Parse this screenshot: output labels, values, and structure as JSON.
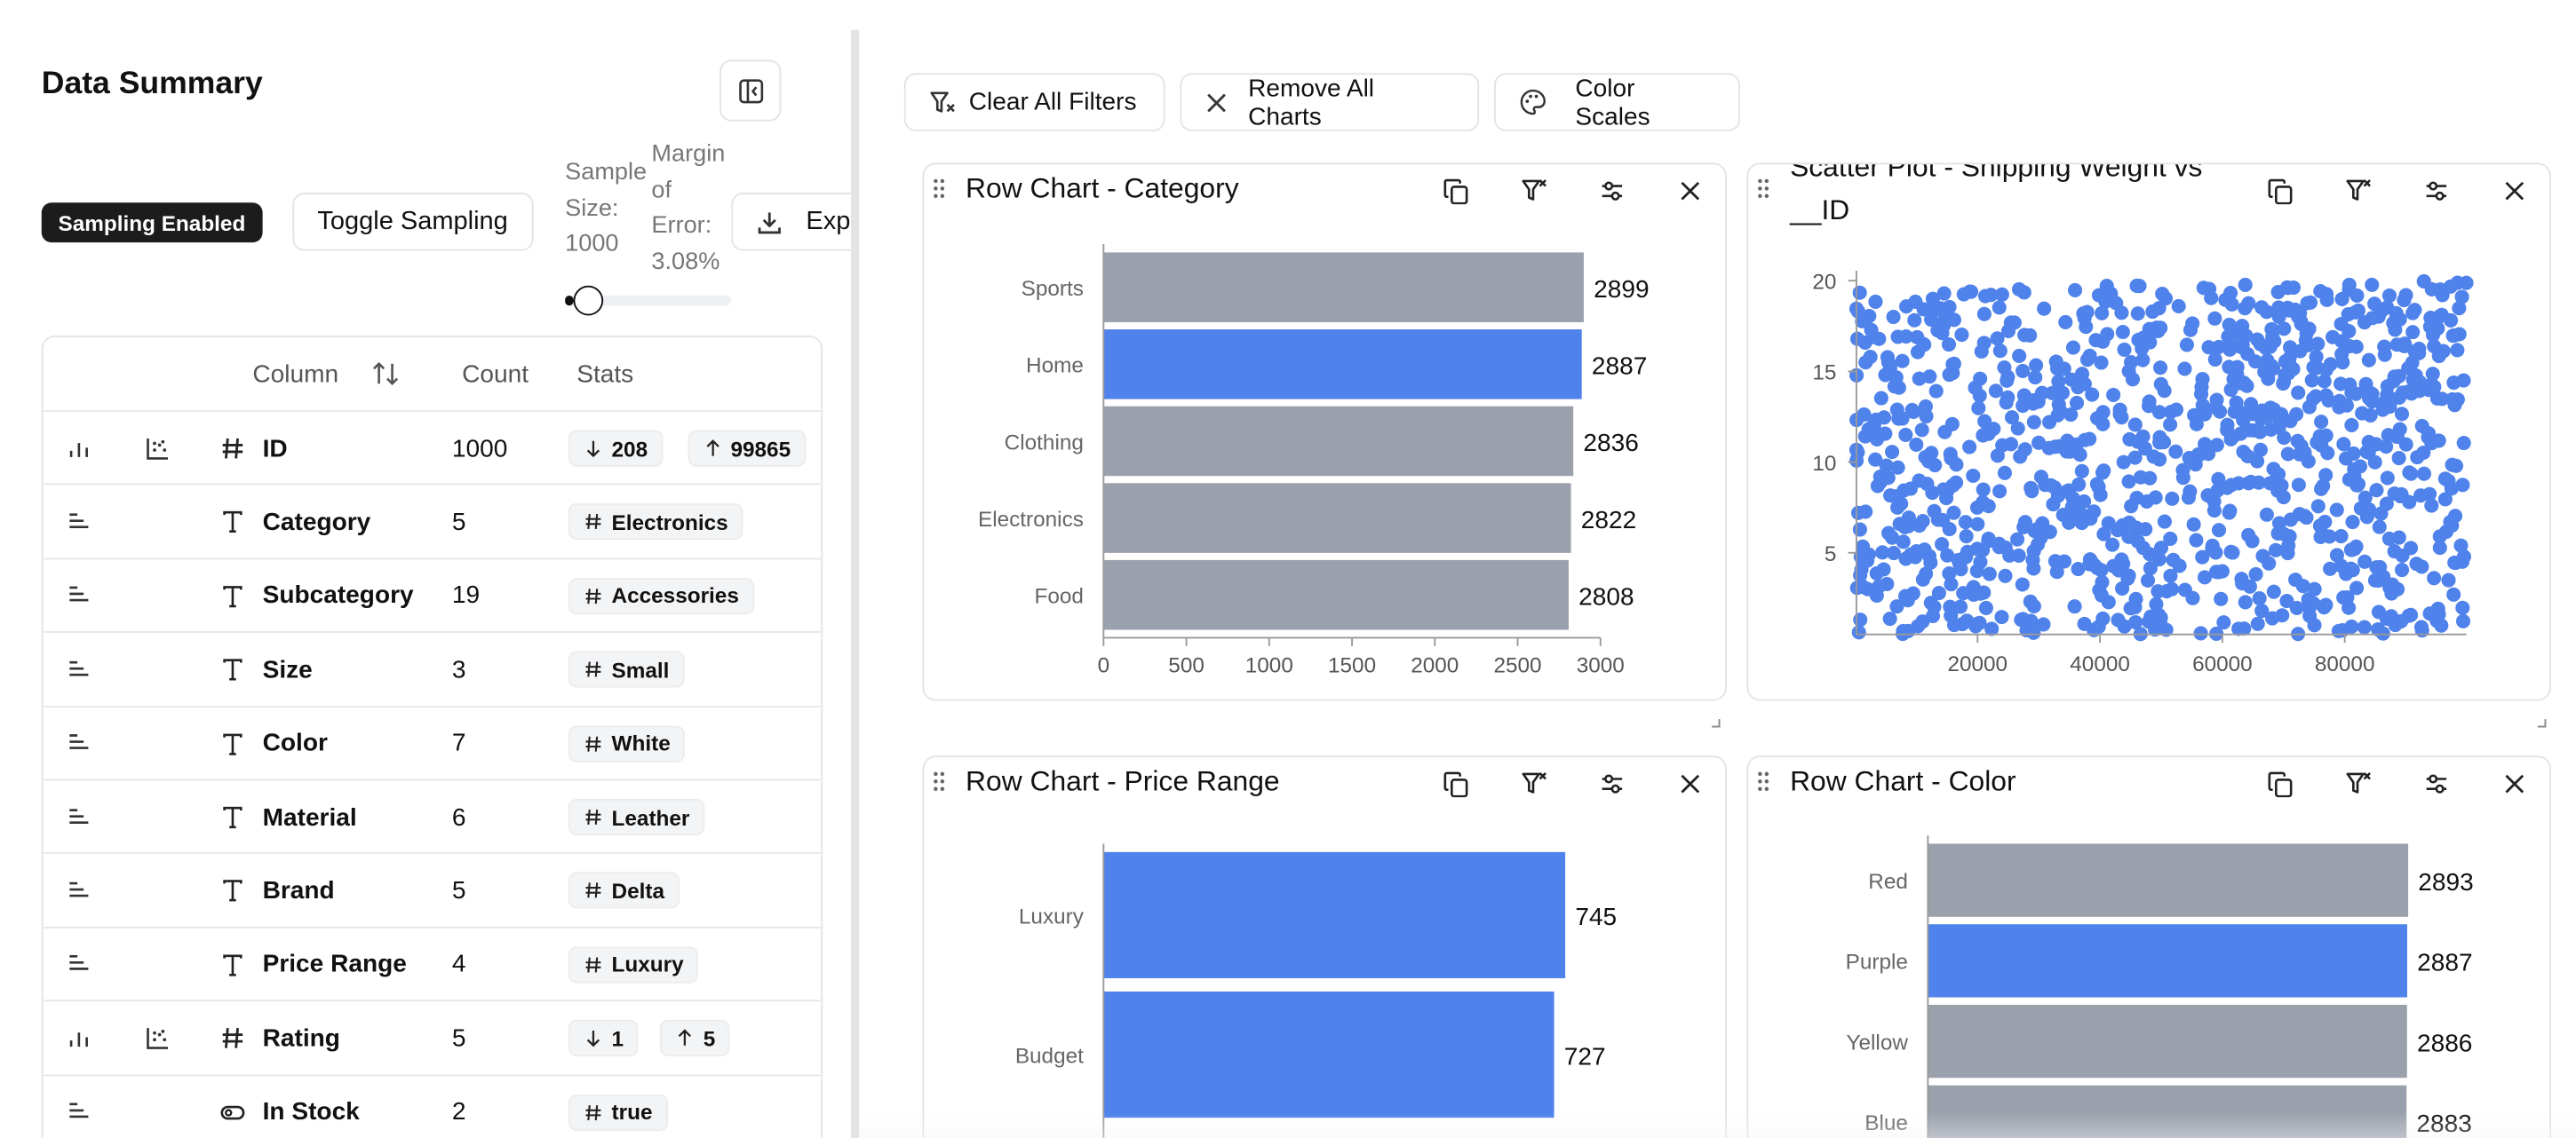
{
  "sidebar": {
    "title": "Data Summary",
    "sampling_badge": "Sampling Enabled",
    "toggle_button": "Toggle Sampling",
    "export_button": "Exp",
    "sample_size_label": "Sample Size: 1000",
    "margin_of_error_label": "Margin of Error: 3.08%",
    "sample_slider_fraction": 0.05,
    "table": {
      "headers": {
        "column": "Column",
        "count": "Count",
        "stats": "Stats"
      },
      "rows": [
        {
          "name": "ID",
          "type_icon": "hash-icon",
          "count": "1000",
          "numeric": true,
          "stats": [
            {
              "icon": "arrow-down-icon",
              "text": "208"
            },
            {
              "icon": "arrow-up-icon",
              "text": "99865"
            }
          ]
        },
        {
          "name": "Category",
          "type_icon": "text-type-icon",
          "count": "5",
          "numeric": false,
          "stats": [
            {
              "icon": "hash-icon",
              "text": "Electronics"
            }
          ]
        },
        {
          "name": "Subcategory",
          "type_icon": "text-type-icon",
          "count": "19",
          "numeric": false,
          "stats": [
            {
              "icon": "hash-icon",
              "text": "Accessories"
            }
          ]
        },
        {
          "name": "Size",
          "type_icon": "text-type-icon",
          "count": "3",
          "numeric": false,
          "stats": [
            {
              "icon": "hash-icon",
              "text": "Small"
            }
          ]
        },
        {
          "name": "Color",
          "type_icon": "text-type-icon",
          "count": "7",
          "numeric": false,
          "stats": [
            {
              "icon": "hash-icon",
              "text": "White"
            }
          ]
        },
        {
          "name": "Material",
          "type_icon": "text-type-icon",
          "count": "6",
          "numeric": false,
          "stats": [
            {
              "icon": "hash-icon",
              "text": "Leather"
            }
          ]
        },
        {
          "name": "Brand",
          "type_icon": "text-type-icon",
          "count": "5",
          "numeric": false,
          "stats": [
            {
              "icon": "hash-icon",
              "text": "Delta"
            }
          ]
        },
        {
          "name": "Price Range",
          "type_icon": "text-type-icon",
          "count": "4",
          "numeric": false,
          "stats": [
            {
              "icon": "hash-icon",
              "text": "Luxury"
            }
          ]
        },
        {
          "name": "Rating",
          "type_icon": "hash-icon",
          "count": "5",
          "numeric": true,
          "stats": [
            {
              "icon": "arrow-down-icon",
              "text": "1"
            },
            {
              "icon": "arrow-up-icon",
              "text": "5"
            }
          ]
        },
        {
          "name": "In Stock",
          "type_icon": "toggle-icon",
          "count": "2",
          "numeric": false,
          "stats": [
            {
              "icon": "hash-icon",
              "text": "true"
            }
          ]
        }
      ]
    }
  },
  "toolbar": {
    "clear_filters": "Clear All Filters",
    "remove_charts": "Remove All Charts",
    "color_scales": "Color Scales"
  },
  "colors": {
    "accent": "#4f82ea",
    "bar_gray": "#9ba1ac"
  },
  "charts": [
    {
      "title": "Row Chart - Category"
    },
    {
      "title": "Scatter Plot - Shipping Weight vs __ID"
    },
    {
      "title": "Row Chart - Price Range"
    },
    {
      "title": "Row Chart - Color"
    }
  ],
  "chart_data": [
    {
      "type": "bar",
      "orientation": "horizontal",
      "title": "Row Chart - Category",
      "categories": [
        "Sports",
        "Home",
        "Clothing",
        "Electronics",
        "Food"
      ],
      "values": [
        2899,
        2887,
        2836,
        2822,
        2808
      ],
      "selected": [
        false,
        true,
        false,
        false,
        false
      ],
      "xlim": [
        0,
        3000
      ],
      "xticks": [
        0,
        500,
        1000,
        1500,
        2000,
        2500,
        3000
      ]
    },
    {
      "type": "scatter",
      "title": "Scatter Plot - Shipping Weight vs __ID",
      "xlim": [
        208,
        99865
      ],
      "ylim": [
        0.5,
        20
      ],
      "xticks": [
        20000,
        40000,
        60000,
        80000
      ],
      "yticks": [
        5,
        10,
        15,
        20
      ],
      "points": "1000 points uniformly spread over x 208–99865, y 0.5–20"
    },
    {
      "type": "bar",
      "orientation": "horizontal",
      "title": "Row Chart - Price Range",
      "categories": [
        "Luxury",
        "Budget"
      ],
      "values": [
        745,
        727
      ],
      "selected": [
        true,
        true
      ]
    },
    {
      "type": "bar",
      "orientation": "horizontal",
      "title": "Row Chart - Color",
      "categories": [
        "Red",
        "Purple",
        "Yellow",
        "Blue"
      ],
      "values": [
        2893,
        2887,
        2886,
        2883
      ],
      "selected": [
        false,
        true,
        false,
        false
      ]
    }
  ]
}
